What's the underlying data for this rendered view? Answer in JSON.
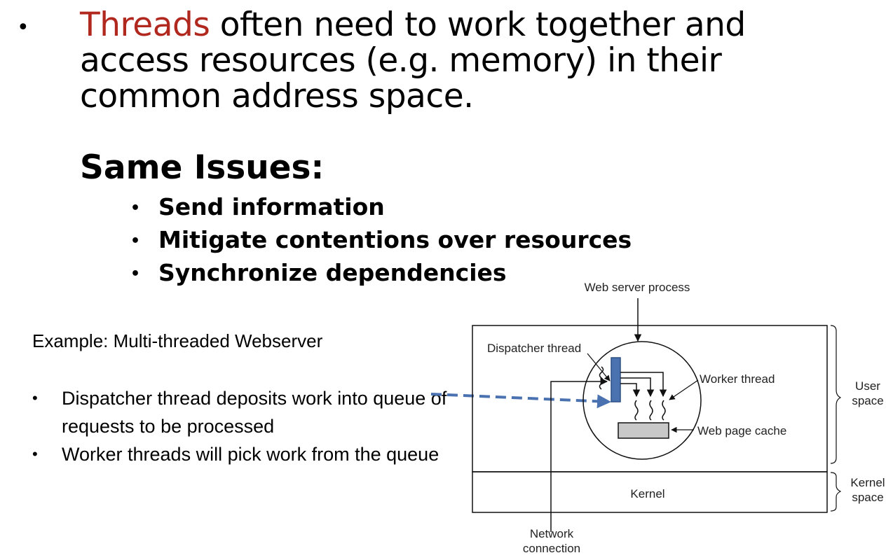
{
  "slide": {
    "main_bullet": {
      "highlight": "Threads",
      "text": " often need to work together and access resources (e.g. memory) in their common address space."
    },
    "issues": {
      "heading": "Same Issues:",
      "items": [
        "Send information",
        "Mitigate contentions over resources",
        "Synchronize dependencies"
      ]
    },
    "example": {
      "title": "Example: Multi-threaded Webserver",
      "items": [
        "Dispatcher thread deposits work into queue of requests to be processed",
        "Worker threads will pick work from the queue"
      ]
    },
    "diagram": {
      "web_server_process": "Web server process",
      "dispatcher_thread": "Dispatcher thread",
      "worker_thread": "Worker thread",
      "web_page_cache": "Web page cache",
      "user_space": [
        "User",
        "space"
      ],
      "kernel_space": [
        "Kernel",
        "space"
      ],
      "kernel": "Kernel",
      "network_connection": [
        "Network",
        "connection"
      ]
    },
    "colors": {
      "highlight_red": "#b0281e",
      "arrow_blue": "#4a72b0",
      "dispatcher_fill": "#4a72b0",
      "cache_fill": "#c8c8c8"
    }
  }
}
